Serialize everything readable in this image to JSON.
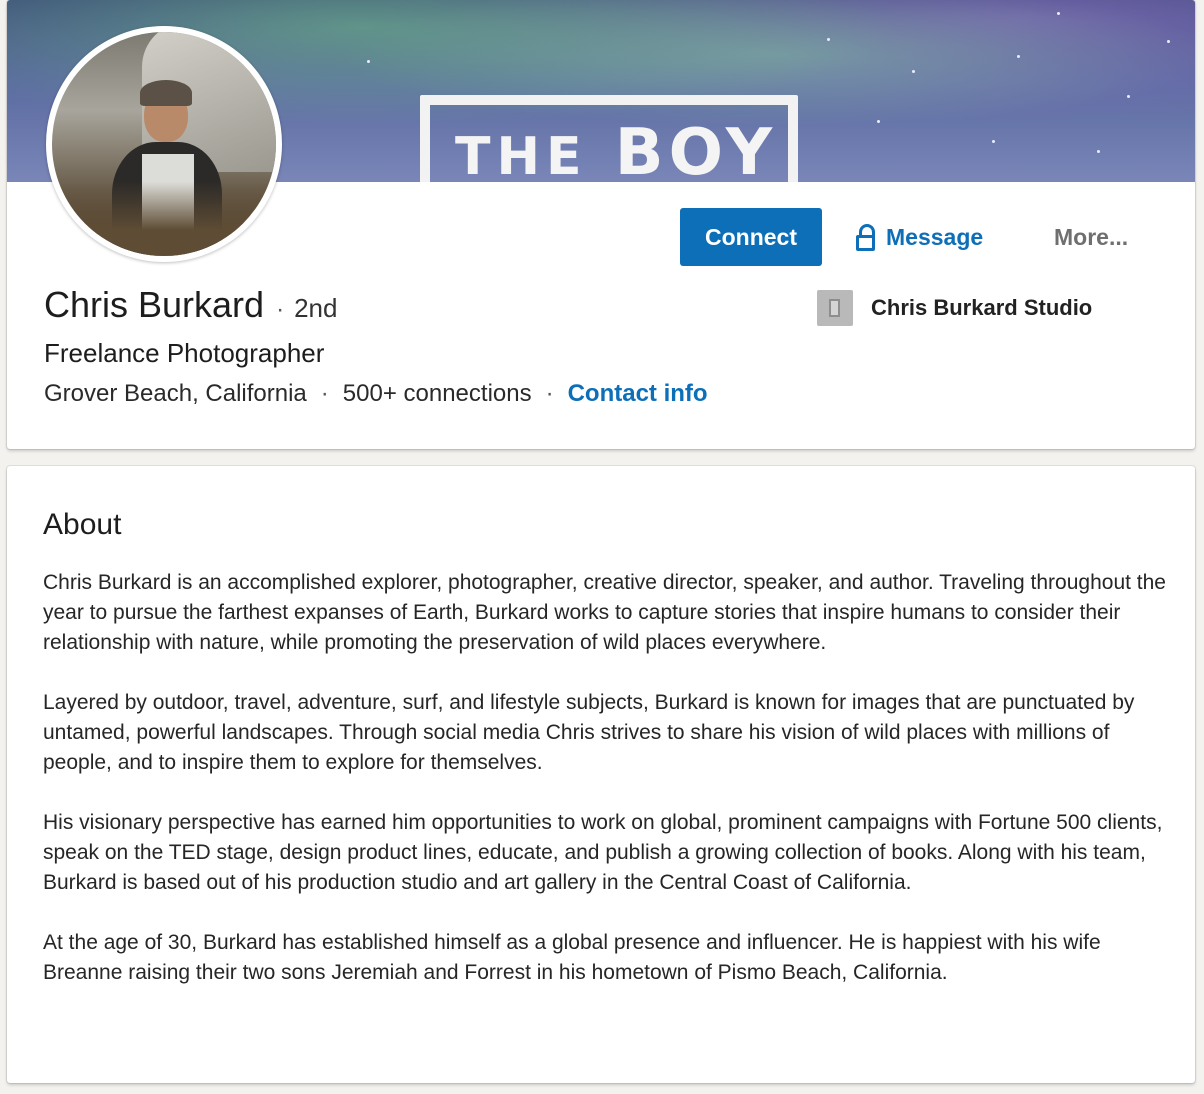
{
  "banner": {
    "text_line1": "THE",
    "text_line2": "BOY"
  },
  "profile": {
    "name": "Chris Burkard",
    "separator": "·",
    "degree": "2nd",
    "headline": "Freelance Photographer",
    "location": "Grover Beach, California",
    "connections": "500+ connections",
    "contact_label": "Contact info"
  },
  "actions": {
    "connect_label": "Connect",
    "message_label": "Message",
    "more_label": "More..."
  },
  "company": {
    "name": "Chris Burkard Studio",
    "icon": "building-icon"
  },
  "about": {
    "title": "About",
    "paragraphs": [
      "Chris Burkard is an accomplished explorer, photographer, creative director, speaker, and author. Traveling throughout the year to pursue the farthest expanses of Earth, Burkard works to capture stories that inspire humans to consider their relationship with nature, while promoting the preservation of wild places everywhere.",
      "Layered by outdoor, travel, adventure, surf, and lifestyle subjects, Burkard is known for images that are punctuated by untamed, powerful landscapes. Through social media Chris strives to share his vision of wild places with millions of people, and to inspire them to explore for themselves.",
      "His visionary perspective has earned him opportunities to work on global, prominent campaigns with Fortune 500 clients, speak on the TED stage, design product lines, educate, and publish a growing collection of books. Along with his team, Burkard is based out of his production studio and art gallery in the Central Coast of California.",
      "At the age of 30, Burkard has established himself as a global presence and influencer. He is happiest with his wife Breanne raising their two sons Jeremiah and Forrest in his hometown of Pismo Beach, California."
    ]
  },
  "colors": {
    "link": "#0d6fb8",
    "page_bg": "#f3f2ef",
    "card_bg": "#ffffff",
    "muted": "#6f6f6f"
  },
  "icons": [
    "lock-icon",
    "building-icon"
  ]
}
